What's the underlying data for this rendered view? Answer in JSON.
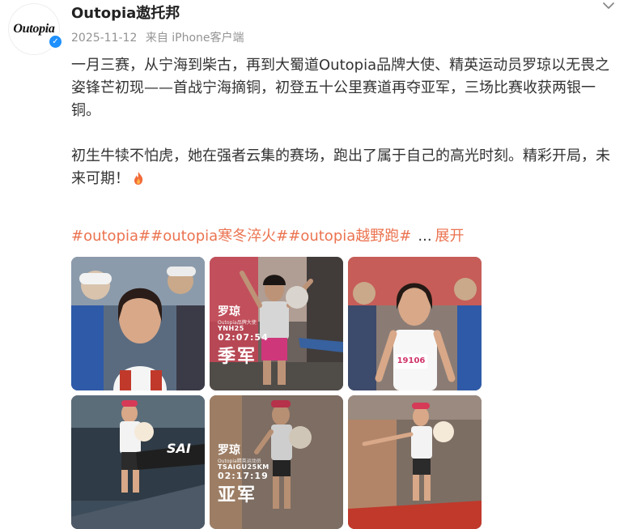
{
  "author": {
    "name": "Outopia遨托邦",
    "avatar_text": "Outopia",
    "verified_mark": "✓"
  },
  "meta": {
    "date": "2025-11-12",
    "source": "来自 iPhone客户端"
  },
  "post": {
    "paragraph1": "一月三赛，从宁海到柴古，再到大蜀道Outopia品牌大使、精英运动员罗琼以无畏之姿锋芒初现——首战宁海摘铜，初登五十公里赛道再夺亚军，三场比赛收获两银一铜。",
    "paragraph2": "初生牛犊不怕虎，她在强者云集的赛场，跑出了属于自己的高光时刻。精彩开局，未来可期！"
  },
  "tags": [
    "#outopia#",
    "#outopia寒冬淬火#",
    "#outopia越野跑#"
  ],
  "more": {
    "ellipsis": "...",
    "expand_label": "展开"
  },
  "photos": [
    {
      "id": "photo-1"
    },
    {
      "id": "photo-2",
      "name": "罗琼",
      "sub": "Outopia品牌大使",
      "event": "YNH25",
      "time": "02:07:54",
      "place": "季军"
    },
    {
      "id": "photo-3",
      "bib": "19106"
    },
    {
      "id": "photo-4",
      "banner": "SAI"
    },
    {
      "id": "photo-5",
      "name": "罗琼",
      "sub": "Outopia精英运动员",
      "event": "TSAIGU25KM",
      "time": "02:17:19",
      "place": "亚军"
    },
    {
      "id": "photo-6"
    }
  ],
  "colors": {
    "tag": "#eb7350",
    "verified": "#1e90ff",
    "meta": "#939393",
    "text": "#333333"
  },
  "icons": {
    "chevron": "chevron-down-icon",
    "fire": "fire-icon",
    "verified": "verified-badge-icon"
  }
}
